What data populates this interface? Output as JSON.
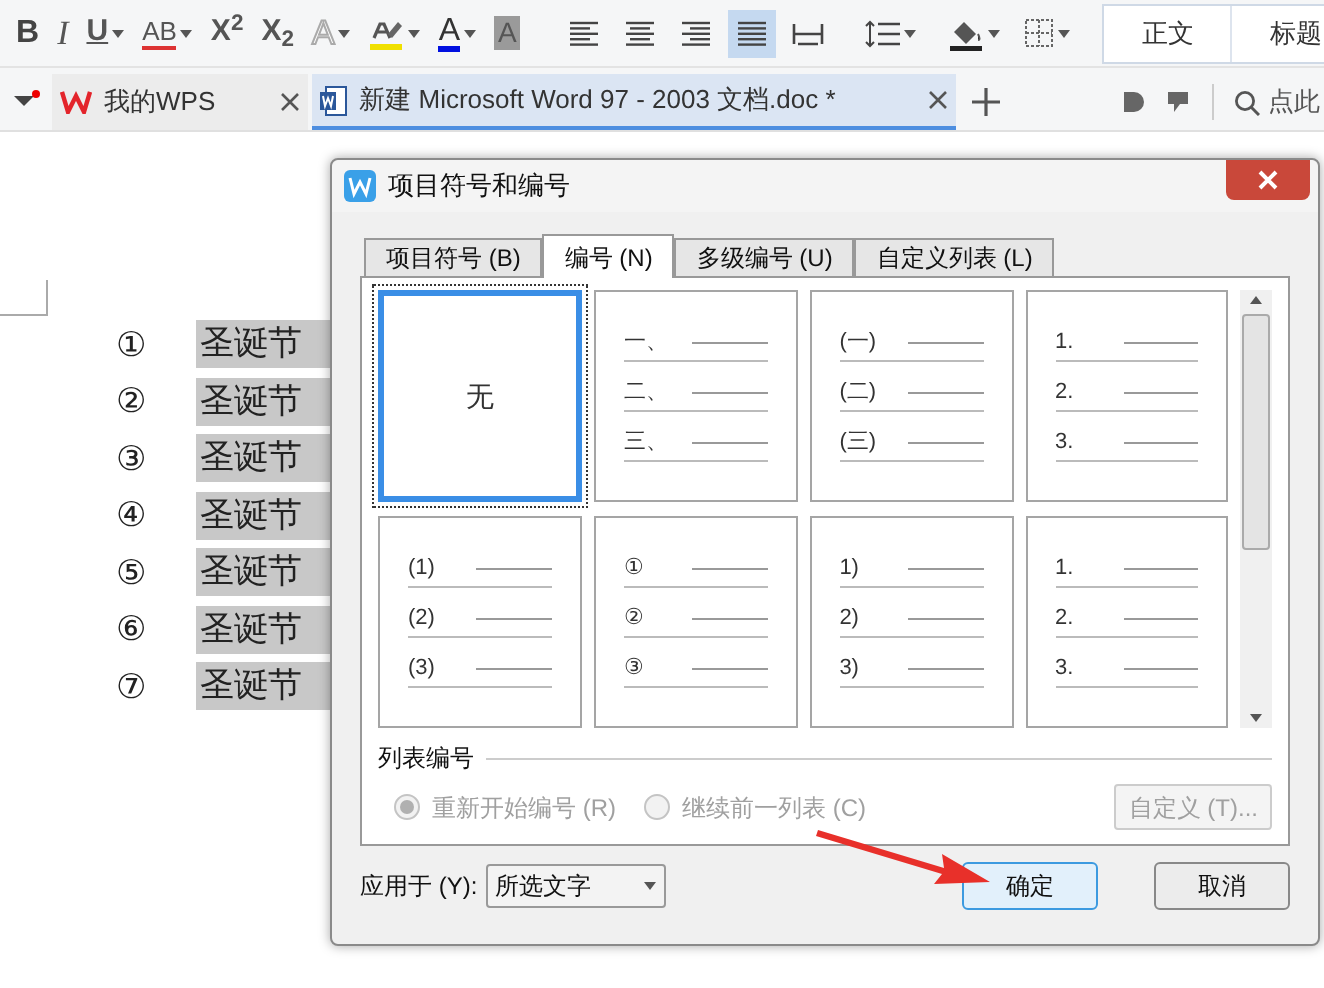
{
  "toolbar": {
    "format_buttons": [
      {
        "kind": "bold",
        "label": "B",
        "dropdown": false
      },
      {
        "kind": "italic",
        "label": "I",
        "dropdown": false
      },
      {
        "kind": "underline",
        "label": "U",
        "dropdown": true
      },
      {
        "kind": "strike",
        "label": "AB",
        "dropdown": true
      },
      {
        "kind": "script",
        "label": "X$^{2}$",
        "dropdown": false
      },
      {
        "kind": "script",
        "label": "X$_{2}$",
        "dropdown": false
      },
      {
        "kind": "outline",
        "label": "A",
        "dropdown": true
      },
      {
        "kind": "highlight",
        "dropdown": true
      },
      {
        "kind": "color",
        "label": "A",
        "dropdown": true
      },
      {
        "kind": "shade",
        "label": "A",
        "dropdown": false
      }
    ],
    "align_buttons": [
      {
        "kind": "left",
        "selected": false
      },
      {
        "kind": "center",
        "selected": false
      },
      {
        "kind": "right",
        "selected": false
      },
      {
        "kind": "justify",
        "selected": true
      },
      {
        "kind": "distributed",
        "selected": false
      }
    ],
    "styles": [
      {
        "label": "正文"
      },
      {
        "label": "标题"
      }
    ]
  },
  "tabs": [
    {
      "label": "我的WPS",
      "kind": "home",
      "selected": false
    },
    {
      "label": "新建 Microsoft Word 97 - 2003 文档.doc *",
      "kind": "doc",
      "selected": true
    }
  ],
  "search": {
    "placeholder": "点此"
  },
  "document": {
    "items": [
      {
        "number": "①",
        "text": "圣诞节"
      },
      {
        "number": "②",
        "text": "圣诞节"
      },
      {
        "number": "③",
        "text": "圣诞节"
      },
      {
        "number": "④",
        "text": "圣诞节"
      },
      {
        "number": "⑤",
        "text": "圣诞节"
      },
      {
        "number": "⑥",
        "text": "圣诞节"
      },
      {
        "number": "⑦",
        "text": "圣诞节"
      }
    ]
  },
  "dialog": {
    "title": "项目符号和编号",
    "tabs": [
      {
        "label": "项目符号 (B)",
        "selected": false
      },
      {
        "label": "编号 (N)",
        "selected": true
      },
      {
        "label": "多级编号 (U)",
        "selected": false
      },
      {
        "label": "自定义列表 (L)",
        "selected": false
      }
    ],
    "styles": [
      {
        "kind": "none",
        "label": "无",
        "selected": true
      },
      {
        "kind": "list",
        "markers": [
          "一、",
          "二、",
          "三、"
        ],
        "selected": false
      },
      {
        "kind": "list",
        "markers": [
          "(一)",
          "(二)",
          "(三)"
        ],
        "selected": false
      },
      {
        "kind": "list",
        "markers": [
          "1.",
          "2.",
          "3."
        ],
        "selected": false
      },
      {
        "kind": "list",
        "markers": [
          "(1)",
          "(2)",
          "(3)"
        ],
        "selected": false
      },
      {
        "kind": "list",
        "markers": [
          "①",
          "②",
          "③"
        ],
        "selected": false
      },
      {
        "kind": "list",
        "markers": [
          "1)",
          "2)",
          "3)"
        ],
        "selected": false
      },
      {
        "kind": "list",
        "markers": [
          "1.",
          "2.",
          "3."
        ],
        "selected": false
      }
    ],
    "list_numbering": {
      "title": "列表编号",
      "options": [
        {
          "label": "重新开始编号 (R)",
          "checked": true,
          "disabled": true
        },
        {
          "label": "继续前一列表 (C)",
          "checked": false,
          "disabled": true
        }
      ],
      "custom_button": {
        "label": "自定义 (T)...",
        "disabled": true
      }
    },
    "apply_to": {
      "label": "应用于 (Y):",
      "value": "所选文字"
    },
    "buttons": [
      "确定",
      "取消"
    ]
  }
}
